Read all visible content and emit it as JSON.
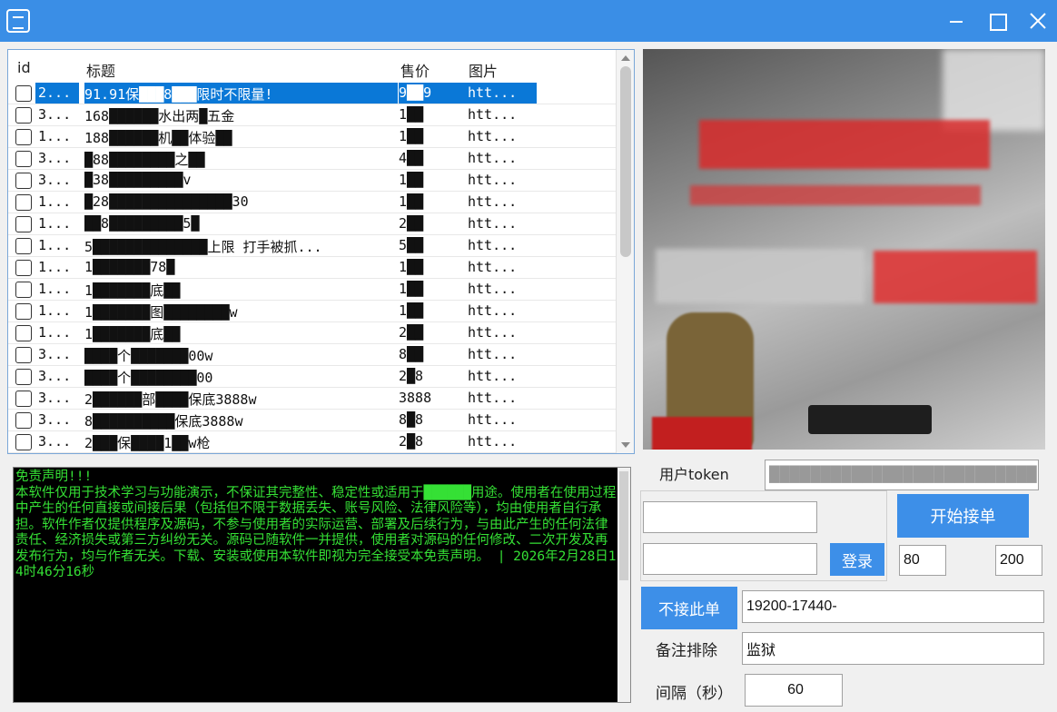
{
  "window": {
    "icon": "app-logo-icon",
    "controls": [
      "minimize-icon",
      "maximize-icon",
      "close-icon"
    ]
  },
  "table": {
    "columns": [
      "id",
      "标题",
      "售价",
      "图片"
    ],
    "rows": [
      {
        "id": "2...",
        "title": "91.91保███8███限时不限量!",
        "price": "9██9",
        "img": "htt...",
        "selected": true
      },
      {
        "id": "3...",
        "title": "168██████水出两█五金",
        "price": "1██",
        "img": "htt..."
      },
      {
        "id": "1...",
        "title": "188██████机██体验██",
        "price": "1██",
        "img": "htt..."
      },
      {
        "id": "3...",
        "title": "█88████████之██",
        "price": "4██",
        "img": "htt..."
      },
      {
        "id": "3...",
        "title": "█38█████████v",
        "price": "1██",
        "img": "htt..."
      },
      {
        "id": "1...",
        "title": "█28███████████████30",
        "price": "1██",
        "img": "htt..."
      },
      {
        "id": "1...",
        "title": "██8█████████5█",
        "price": "2██",
        "img": "htt..."
      },
      {
        "id": "1...",
        "title": "5██████████████上限 打手被抓...",
        "price": "5██",
        "img": "htt..."
      },
      {
        "id": "1...",
        "title": "1███████78█",
        "price": "1██",
        "img": "htt..."
      },
      {
        "id": "1...",
        "title": "1███████底██",
        "price": "1██",
        "img": "htt..."
      },
      {
        "id": "1...",
        "title": "1███████图████████w",
        "price": "1██",
        "img": "htt..."
      },
      {
        "id": "1...",
        "title": "1███████底██",
        "price": "2██",
        "img": "htt..."
      },
      {
        "id": "3...",
        "title": "████个███████00w",
        "price": "8██",
        "img": "htt..."
      },
      {
        "id": "3...",
        "title": "████个████████00",
        "price": "2█8",
        "img": "htt..."
      },
      {
        "id": "3...",
        "title": "2██████部████保底3888w",
        "price": "3888",
        "img": "htt..."
      },
      {
        "id": "3...",
        "title": "8██████████保底3888w",
        "price": "8█8",
        "img": "htt..."
      },
      {
        "id": "3...",
        "title": "2███保████1██w枪",
        "price": "2█8",
        "img": "htt..."
      }
    ]
  },
  "console": {
    "text": "免责声明!!!\n本软件仅用于技术学习与功能演示，不保证其完整性、稳定性或适用于██████用途。使用者在使用过程中产生的任何直接或间接后果（包括但不限于数据丢失、账号风险、法律风险等），均由使用者自行承担。软件作者仅提供程序及源码，不参与使用者的实际运营、部署及后续行为，与由此产生的任何法律责任、经济损失或第三方纠纷无关。源码已随软件一并提供，使用者对源码的任何修改、二次开发及再发布行为，均与作者无关。下载、安装或使用本软件即视为完全接受本免责声明。 | 2026年2月28日14时46分16秒"
  },
  "controls": {
    "token_label": "用户token",
    "token_value": "██████████████████████████",
    "account_value": "",
    "password_value": "",
    "login_label": "登录",
    "start_label": "开始接单",
    "min_value": "80",
    "max_value": "200",
    "skip_label": "不接此单",
    "skip_value": "19200-17440-",
    "exclude_label": "备注排除",
    "exclude_value": "监狱",
    "interval_label": "间隔（秒）",
    "interval_value": "60"
  },
  "colors": {
    "titlebar": "#3a8ee6",
    "button": "#3d8fe8",
    "selection": "#0a78d7",
    "console_text": "#35e035"
  }
}
